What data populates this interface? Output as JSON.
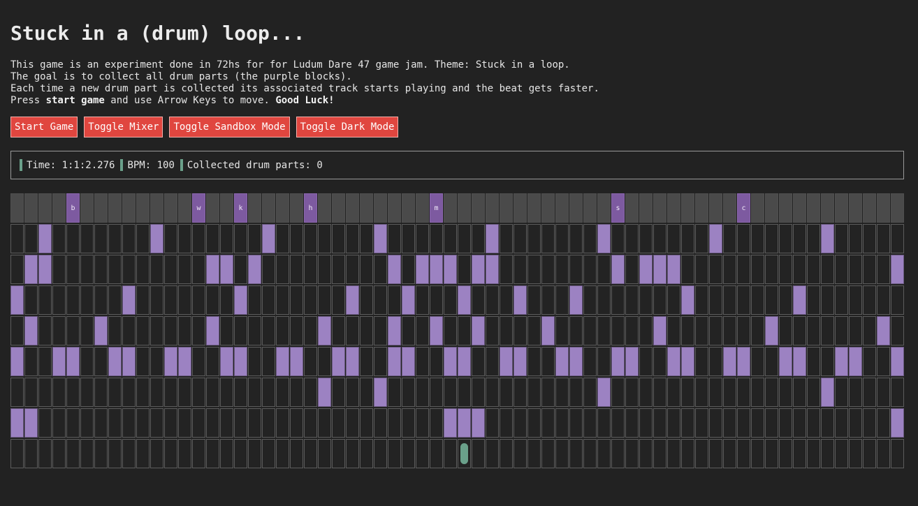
{
  "title": "Stuck in a (drum) loop...",
  "intro": {
    "line1": "This game is an experiment done in 72hs for for Ludum Dare 47 game jam. Theme: Stuck in a loop.",
    "line2": "The goal is to collect all drum parts (the purple blocks).",
    "line3": "Each time a new drum part is collected its associated track starts playing and the beat gets faster.",
    "line4_pre": "Press ",
    "line4_b1": "start game",
    "line4_mid": " and use Arrow Keys to move. ",
    "line4_b2": "Good Luck!"
  },
  "buttons": {
    "start": "Start Game",
    "mixer": "Toggle Mixer",
    "sandbox": "Toggle Sandbox Mode",
    "dark": "Toggle Dark Mode"
  },
  "status": {
    "time_label": "Time: ",
    "time_value": "1:1:2.276",
    "bpm_label": "BPM: ",
    "bpm_value": "100",
    "collected_label": "Collected drum parts: ",
    "collected_value": "0"
  },
  "grid": {
    "columns": 64,
    "header_markers": [
      {
        "col": 4,
        "letter": "b"
      },
      {
        "col": 13,
        "letter": "w"
      },
      {
        "col": 16,
        "letter": "k"
      },
      {
        "col": 21,
        "letter": "h"
      },
      {
        "col": 30,
        "letter": "m"
      },
      {
        "col": 43,
        "letter": "s"
      },
      {
        "col": 52,
        "letter": "c"
      }
    ],
    "tracks": [
      [
        2,
        10,
        18,
        26,
        34,
        42,
        50,
        58
      ],
      [
        1,
        2,
        14,
        15,
        17,
        27,
        29,
        30,
        31,
        33,
        34,
        43,
        45,
        46,
        47,
        63
      ],
      [
        0,
        8,
        16,
        24,
        28,
        32,
        36,
        40,
        48,
        56
      ],
      [
        1,
        6,
        14,
        22,
        27,
        30,
        33,
        38,
        46,
        54,
        62
      ],
      [
        0,
        3,
        4,
        7,
        8,
        11,
        12,
        15,
        16,
        19,
        20,
        23,
        24,
        27,
        28,
        31,
        32,
        35,
        36,
        39,
        40,
        43,
        44,
        47,
        48,
        51,
        52,
        55,
        56,
        59,
        60,
        63
      ],
      [
        22,
        26,
        42,
        58
      ],
      [
        0,
        1,
        31,
        32,
        33,
        63
      ],
      []
    ],
    "player": {
      "track": 7,
      "col": 32
    }
  }
}
